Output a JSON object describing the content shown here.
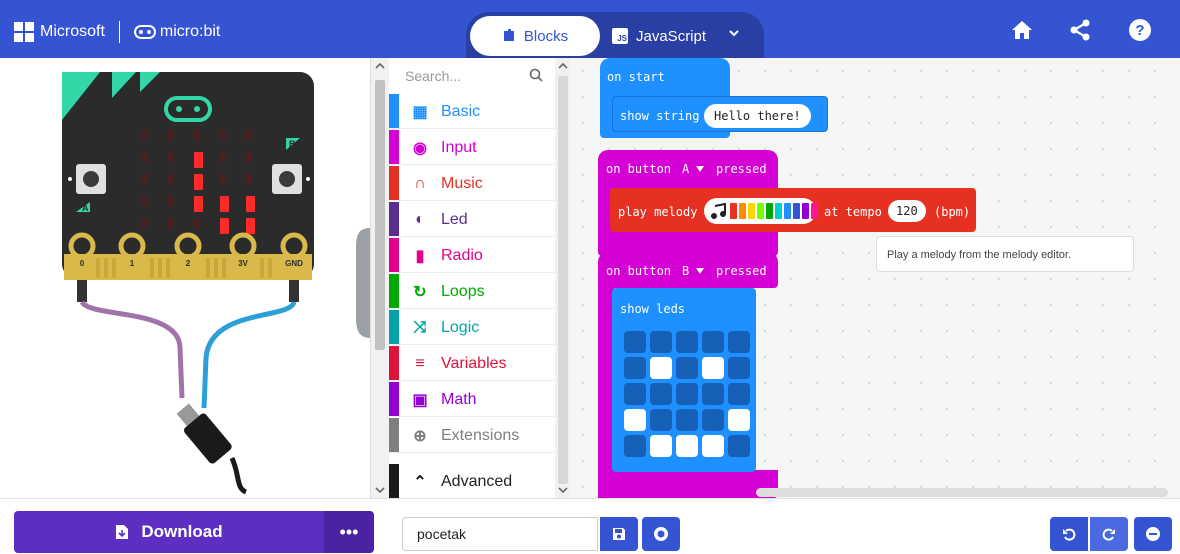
{
  "header": {
    "brand": "Microsoft",
    "product": "micro:bit",
    "tabs": {
      "blocks": "Blocks",
      "javascript": "JavaScript",
      "js_badge": "JS"
    },
    "icons": [
      "home-icon",
      "share-icon",
      "help-icon"
    ]
  },
  "simulator": {
    "pins": [
      "0",
      "1",
      "2",
      "3V",
      "GND"
    ],
    "buttons": [
      "A",
      "B"
    ],
    "led_matrix": [
      [
        0,
        0,
        0,
        0,
        0
      ],
      [
        0,
        0,
        1,
        0,
        0
      ],
      [
        0,
        0,
        1,
        0,
        0
      ],
      [
        0,
        0,
        1,
        1,
        1
      ],
      [
        0,
        0,
        0,
        1,
        1
      ]
    ],
    "colors": {
      "board": "#2b2b2b",
      "led_on": "#ff2b2b",
      "led_off": "#4a2020",
      "accent": "#33d6a6"
    }
  },
  "toolbox": {
    "search_placeholder": "Search...",
    "categories": [
      {
        "label": "Basic",
        "color": "#1e90ff",
        "icon": "grid-icon"
      },
      {
        "label": "Input",
        "color": "#d400d4",
        "icon": "target-icon"
      },
      {
        "label": "Music",
        "color": "#e63022",
        "icon": "headphones-icon"
      },
      {
        "label": "Led",
        "color": "#5c2d91",
        "icon": "toggle-icon"
      },
      {
        "label": "Radio",
        "color": "#e3008c",
        "icon": "signal-icon"
      },
      {
        "label": "Loops",
        "color": "#00aa00",
        "icon": "loop-icon"
      },
      {
        "label": "Logic",
        "color": "#00a4a6",
        "icon": "shuffle-icon"
      },
      {
        "label": "Variables",
        "color": "#dc143c",
        "icon": "list-icon"
      },
      {
        "label": "Math",
        "color": "#9400d3",
        "icon": "calculator-icon"
      },
      {
        "label": "Extensions",
        "color": "#7f7f7f",
        "icon": "plus-circle-icon"
      },
      {
        "label": "Advanced",
        "color": "#1a1a1a",
        "icon": "chevron-up-icon"
      }
    ]
  },
  "workspace": {
    "on_start": {
      "label": "on start",
      "inner": "show string",
      "value": "Hello there!"
    },
    "button_a": {
      "label_on": "on button",
      "button": "A",
      "label_pressed": "pressed",
      "inner": "play melody",
      "tempo_label": "at tempo",
      "tempo": "120",
      "unit": "(bpm)"
    },
    "button_b": {
      "label_on": "on button",
      "button": "B",
      "label_pressed": "pressed",
      "inner": "show leds",
      "leds": [
        [
          0,
          0,
          0,
          0,
          0
        ],
        [
          0,
          1,
          0,
          1,
          0
        ],
        [
          0,
          0,
          0,
          0,
          0
        ],
        [
          1,
          0,
          0,
          0,
          1
        ],
        [
          0,
          1,
          1,
          1,
          0
        ]
      ]
    },
    "tooltip": "Play a melody from the melody editor.",
    "melody_colors": [
      "#e63022",
      "#ff8c00",
      "#ffd700",
      "#7cfc00",
      "#00aa00",
      "#00ced1",
      "#1e90ff",
      "#3454d1",
      "#9400d3",
      "#ff1493"
    ],
    "colors": {
      "basic": "#1e90ff",
      "input": "#d400d4",
      "music": "#e63022"
    }
  },
  "footer": {
    "download_label": "Download",
    "more_label": "•••",
    "project_name": "pocetak"
  }
}
